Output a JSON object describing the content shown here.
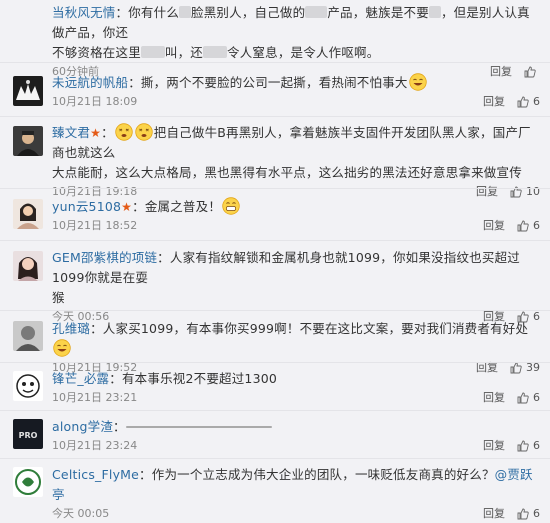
{
  "comments": [
    {
      "name": "当秋风无情",
      "text_a": "：你有什么",
      "text_b": "脸黑别人，自己做的",
      "text_c": "产品，魅族是不要",
      "text_d": "，但是别人认真做产品，你还",
      "line2_a": "不够资格在这里",
      "line2_b": "叫，还",
      "line2_c": "令人窒息，是令人作呕啊。",
      "time": "60分钟前",
      "reply": "回复",
      "likes": ""
    },
    {
      "name": "未远航的帆船",
      "text": "：撕，两个不要脸的公司一起撕，看热闹不怕事大",
      "time": "10月21日 18:09",
      "reply": "回复",
      "likes": "6"
    },
    {
      "name": "臻文君",
      "text_a": "把自己做牛B再黑别人，拿着魅族半支固件开发团队黑人家，国产厂商也就这么",
      "line2": "大点能耐，这么大点格局，黑也黑得有水平点，这么拙劣的黑法还好意思拿来做宣传",
      "time": "10月21日 19:18",
      "reply": "回复",
      "likes": "10"
    },
    {
      "name": "yun云5108",
      "text": "：金属之普及！",
      "time": "10月21日 18:52",
      "reply": "回复",
      "likes": "6"
    },
    {
      "name": "GEM邵紫棋的项链",
      "text": "：人家有指纹解锁和金属机身也就1099，你如果没指纹也买超过1099你就是在耍",
      "line2": "猴",
      "time": "今天 00:56",
      "reply": "回复",
      "likes": "6"
    },
    {
      "name": "孔维璐",
      "text": "：人家买1099，有本事你买999啊！不要在这比文案，要对我们消费者有好处",
      "time": "10月21日 19:52",
      "reply": "回复",
      "likes": "39"
    },
    {
      "name": "锋芒_必露",
      "text": "：有本事乐视2不要超过1300",
      "time": "10月21日 23:21",
      "reply": "回复",
      "likes": "6"
    },
    {
      "name": "along学渣",
      "text": "：",
      "time": "10月21日 23:24",
      "reply": "回复",
      "likes": "6"
    },
    {
      "name": "Celtics_FlyMe",
      "text": "：作为一个立志成为伟大企业的团队，一味贬低友商真的好么？",
      "mention": "@贾跃亭",
      "time": "今天 00:05",
      "reply": "回复",
      "likes": "6"
    }
  ],
  "colors": {
    "name": "#2d6ca2",
    "star": "#e45a17",
    "mention": "#2d6ca2"
  }
}
